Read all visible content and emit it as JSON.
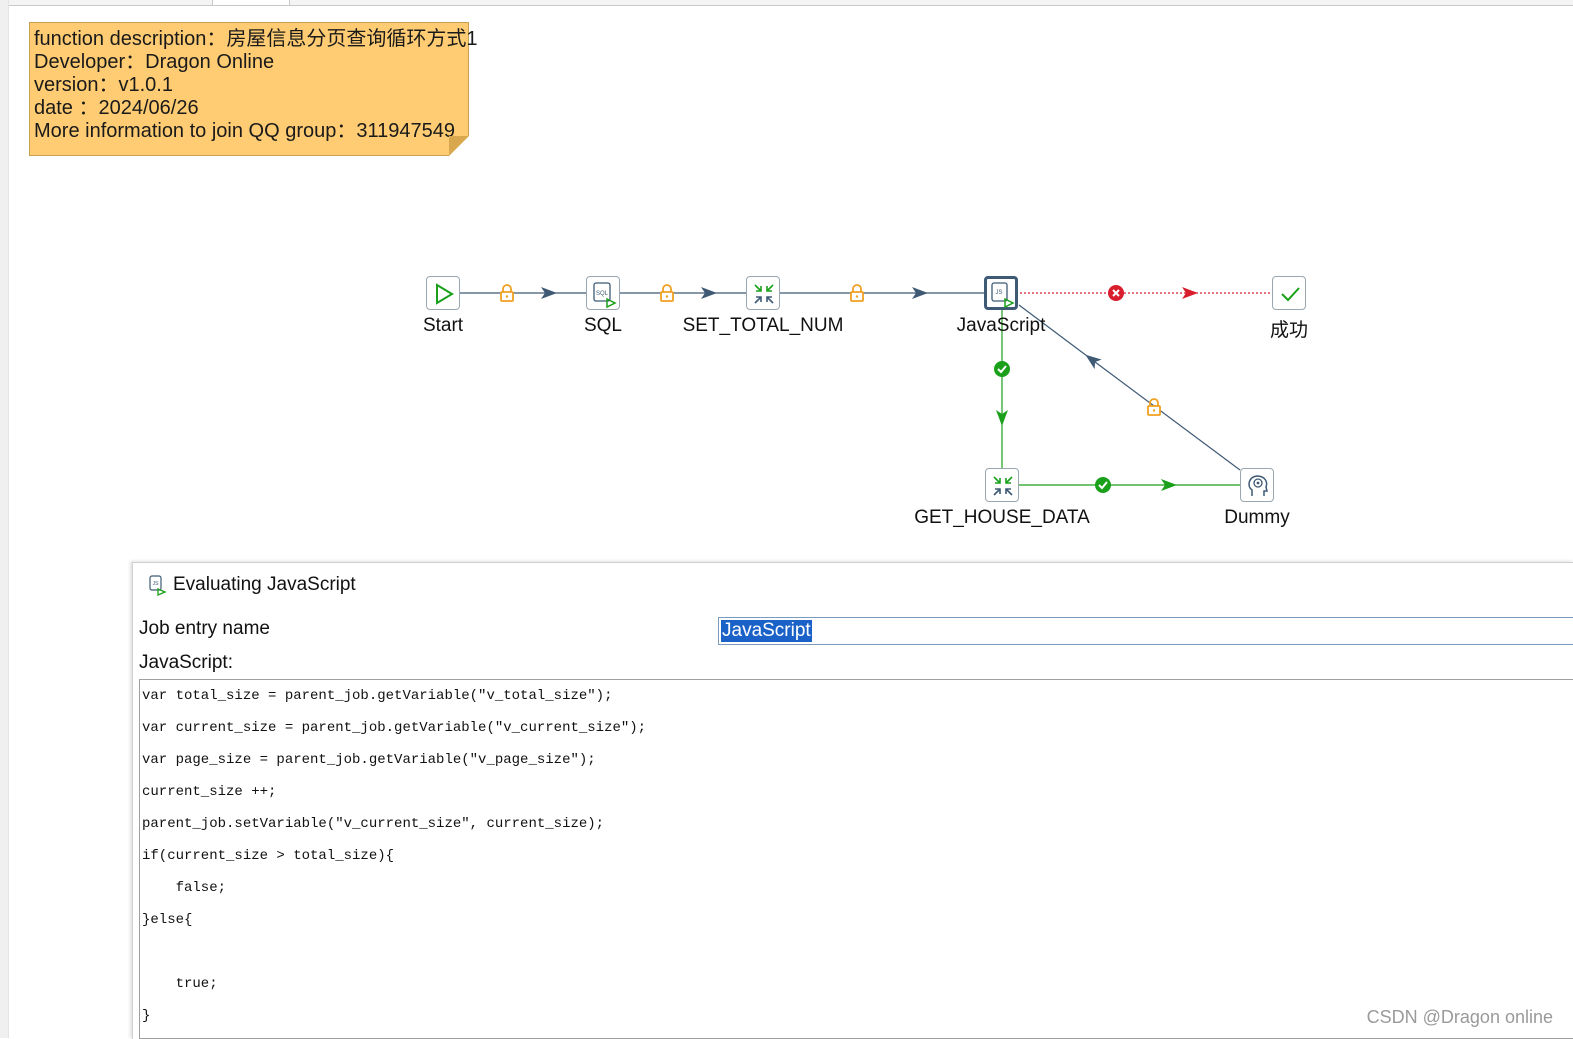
{
  "note": {
    "lines": [
      "function description：房屋信息分页查询循环方式1",
      "Developer：Dragon Online",
      "version：v1.0.1",
      "date ：2024/06/26",
      "More information to join QQ group：311947549"
    ]
  },
  "nodes": {
    "start": "Start",
    "sql": "SQL",
    "set_total_num": "SET_TOTAL_NUM",
    "javascript": "JavaScript",
    "success": "成功",
    "get_house_data": "GET_HOUSE_DATA",
    "dummy": "Dummy"
  },
  "icons": {
    "start": "play-icon",
    "sql": "sql-script-icon",
    "set_total_num": "set-variables-icon",
    "javascript": "javascript-icon",
    "success": "checkmark-icon",
    "get_house_data": "set-variables-icon",
    "dummy": "dummy-icon",
    "hop_unconditional": "lock-icon",
    "hop_true": "check-circle-icon",
    "hop_false": "x-circle-icon"
  },
  "colors": {
    "hop_unconditional": "#3e5a74",
    "hop_true": "#1aa01a",
    "hop_false": "#d81e2c",
    "lock": "#f0a020",
    "note_bg": "#ffcc73"
  },
  "dialog": {
    "title": "Evaluating JavaScript",
    "job_entry_label": "Job entry name",
    "job_entry_value": "JavaScript",
    "script_label": "JavaScript:",
    "code_lines": [
      "var total_size = parent_job.getVariable(\"v_total_size\");",
      "var current_size = parent_job.getVariable(\"v_current_size\");",
      "var page_size = parent_job.getVariable(\"v_page_size\");",
      "current_size ++;",
      "parent_job.setVariable(\"v_current_size\", current_size);",
      "if(current_size > total_size){",
      "    false;",
      "}else{",
      "",
      "    true;",
      "}"
    ]
  },
  "watermark": "CSDN @Dragon online"
}
